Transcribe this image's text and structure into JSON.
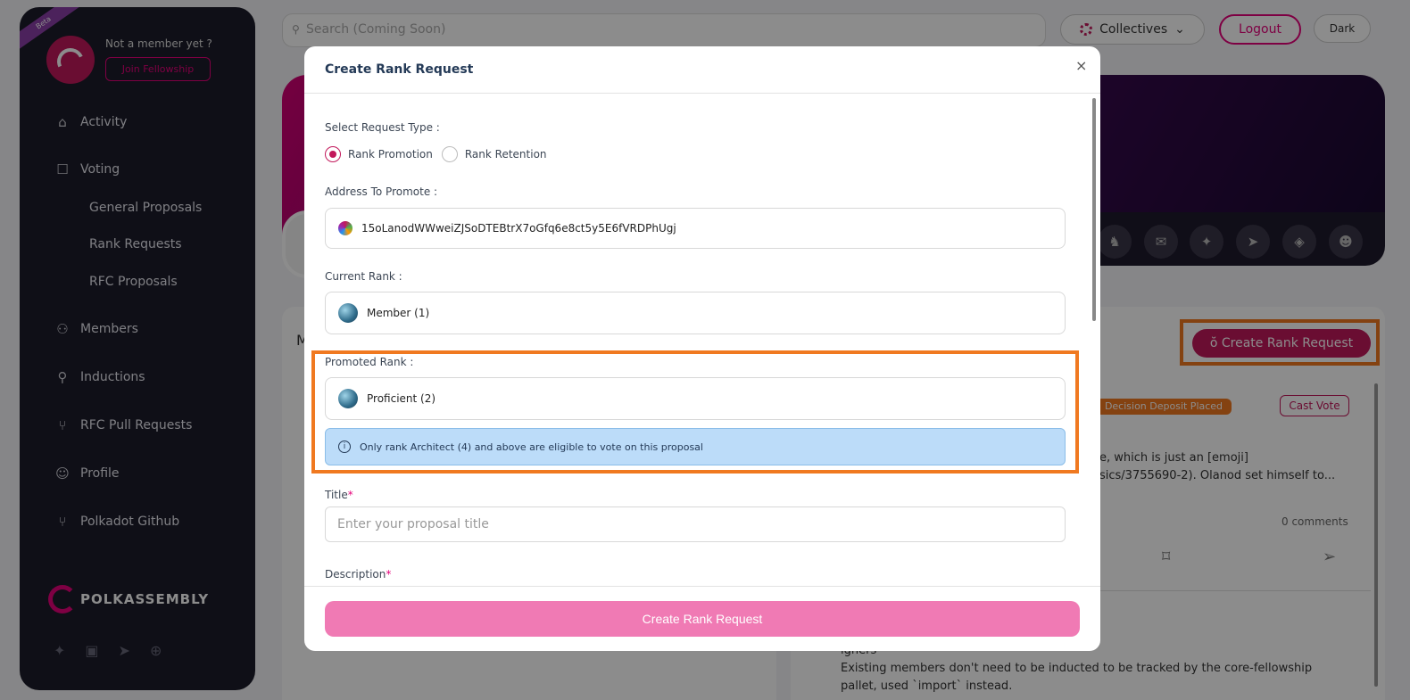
{
  "sidebar": {
    "beta": "Beta",
    "not_member": "Not a member yet ?",
    "join_label": "Join Fellowship",
    "nav": [
      {
        "label": "Activity"
      },
      {
        "label": "Voting"
      },
      {
        "label": "Members"
      },
      {
        "label": "Inductions"
      },
      {
        "label": "RFC Pull Requests"
      },
      {
        "label": "Profile"
      },
      {
        "label": "Polkadot Github"
      }
    ],
    "voting_sub": [
      "General Proposals",
      "Rank Requests",
      "RFC Proposals"
    ],
    "logo_text": "POLKASSEMBLY"
  },
  "header": {
    "search_placeholder": "Search (Coming Soon)",
    "collectives_label": "Collectives",
    "logout_label": "Logout",
    "dark_label": "Dark"
  },
  "main": {
    "create_rank_request_label": "Create Rank Request",
    "status_badge": "Decision Deposit Placed",
    "cast_vote_label": "Cast Vote",
    "snippet_line1": "e, which is just an [emoji]",
    "snippet_line2": "sics/3755690-2). Olanod set himself to...",
    "comments": "0 comments",
    "existing_line1": "Existing members don't need to be inducted to be tracked by the core-fellowship",
    "existing_line2": "pallet, used `import` instead.",
    "partial_heading": "ighers",
    "partial_m": "M"
  },
  "modal": {
    "title": "Create Rank Request",
    "close": "×",
    "request_type_label": "Select Request Type :",
    "option_promotion": "Rank Promotion",
    "option_retention": "Rank Retention",
    "address_label": "Address To Promote :",
    "address_value": "15oLanodWWweiZJSoDTEBtrX7oGfq6e8ct5y5E6fVRDPhUgj",
    "current_rank_label": "Current Rank :",
    "current_rank_value": "Member (1)",
    "promoted_rank_label": "Promoted Rank :",
    "promoted_rank_value": "Proficient (2)",
    "info_text": "Only rank Architect (4) and above are eligible to vote on this proposal",
    "title_label": "Title",
    "title_placeholder": "Enter your proposal title",
    "description_label": "Description",
    "submit_label": "Create Rank Request"
  },
  "colors": {
    "accent": "#E5007A",
    "highlight": "#F07920",
    "submit": "#F07AB4"
  }
}
